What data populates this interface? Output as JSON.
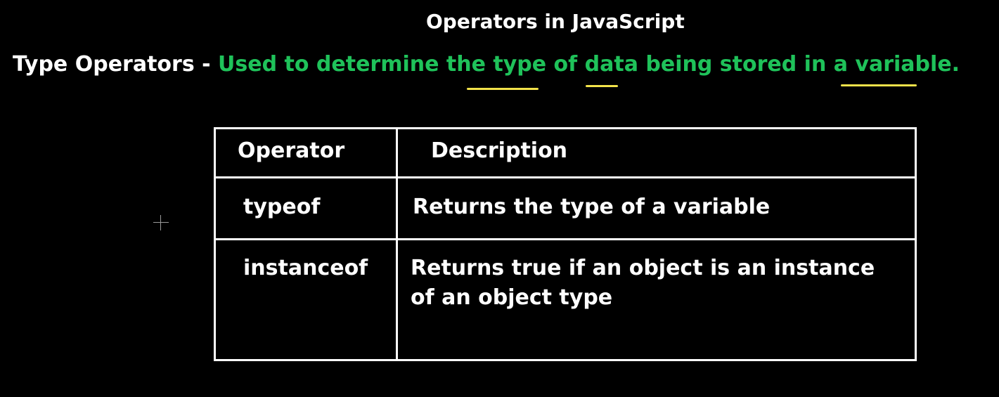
{
  "title": "Operators in JavaScript",
  "subtitle": {
    "label": "Type Operators - ",
    "description": "Used to determine the type of data being stored in a variable."
  },
  "colors": {
    "background": "#000000",
    "text": "#ffffff",
    "description": "#1fc25a",
    "highlight": "#f2e24a"
  },
  "table": {
    "headers": [
      "Operator",
      "Description"
    ],
    "rows": [
      [
        "typeof",
        "Returns the type of a variable"
      ],
      [
        "instanceof",
        "Returns true if an object is an instance of an object type"
      ]
    ]
  }
}
